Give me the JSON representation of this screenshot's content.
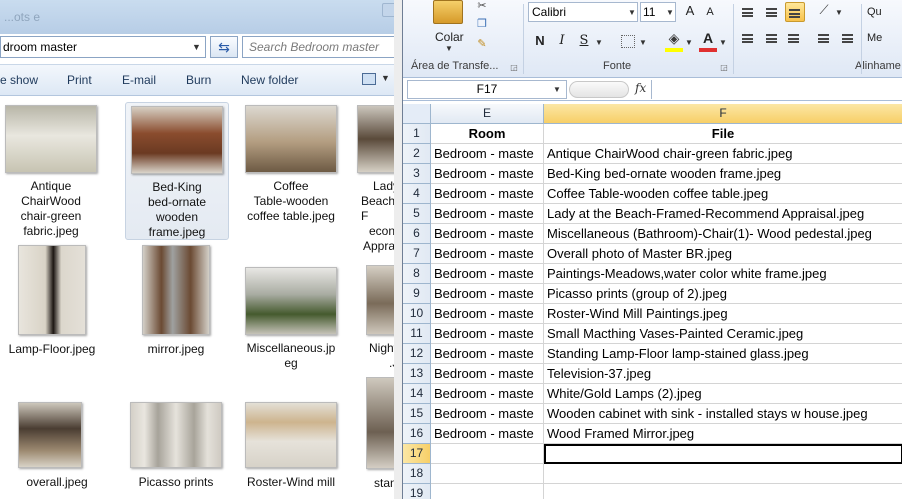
{
  "explorer": {
    "title_ghost": "...ots e",
    "address": "droom master",
    "search_placeholder": "Search Bedroom master",
    "toolbar": {
      "slideshow": "e show",
      "print": "Print",
      "email": "E-mail",
      "burn": "Burn",
      "new_folder": "New folder"
    },
    "files": [
      {
        "label": "Antique ChairWood chair-green fabric.jpeg",
        "lines": [
          "Antique",
          "ChairWood",
          "chair-green",
          "fabric.jpeg"
        ]
      },
      {
        "label": "Bed-King bed-ornate wooden frame.jpeg",
        "lines": [
          "Bed-King",
          "bed-ornate",
          "wooden",
          "frame.jpeg"
        ]
      },
      {
        "label": "Coffee Table-wooden coffee table.jpeg",
        "lines": [
          "Coffee",
          "Table-wooden",
          "coffee table.jpeg"
        ]
      },
      {
        "label": "Lady at the Beach-Framed-Recommend Appraisal.jpeg",
        "lines": [
          "Lady",
          "Beach-F",
          "econ",
          "Apprai"
        ]
      },
      {
        "label": "Lamp-Floor.jpeg",
        "lines": [
          "Lamp-Floor.jpeg"
        ]
      },
      {
        "label": "mirror.jpeg",
        "lines": [
          "mirror.jpeg"
        ]
      },
      {
        "label": "Miscellaneous.jpeg",
        "lines": [
          "Miscellaneous.jp",
          "eg"
        ]
      },
      {
        "label": "Night...",
        "lines": [
          "Night",
          ".J"
        ]
      },
      {
        "label": "overall.jpeg",
        "lines": [
          "overall.jpeg"
        ]
      },
      {
        "label": "Picasso prints",
        "lines": [
          "Picasso prints"
        ]
      },
      {
        "label": "Roster-Wind mill",
        "lines": [
          "Roster-Wind mill"
        ]
      },
      {
        "label": "stan",
        "lines": [
          "stan"
        ]
      }
    ]
  },
  "excel": {
    "ribbon": {
      "paste_label": "Colar",
      "clipboard_group": "Área de Transfe...",
      "font_name": "Calibri",
      "font_size": "11",
      "grow_font": "A",
      "shrink_font": "A",
      "bold": "N",
      "italic": "I",
      "underline": "S",
      "font_group": "Fonte",
      "alignment_group": "Alinhame",
      "right_top": "Qu",
      "right_mid": "Me"
    },
    "name_box": "F17",
    "fx_label": "fx",
    "columns": [
      {
        "id": "E",
        "active": false
      },
      {
        "id": "F",
        "active": true
      }
    ],
    "rows": [
      {
        "num": "1",
        "e": "Room",
        "f": "File",
        "header": true
      },
      {
        "num": "2",
        "e": "Bedroom - maste",
        "f": "Antique ChairWood chair-green fabric.jpeg"
      },
      {
        "num": "3",
        "e": "Bedroom - maste",
        "f": "Bed-King bed-ornate wooden frame.jpeg"
      },
      {
        "num": "4",
        "e": "Bedroom - maste",
        "f": "Coffee Table-wooden coffee table.jpeg"
      },
      {
        "num": "5",
        "e": "Bedroom - maste",
        "f": "Lady at the Beach-Framed-Recommend Appraisal.jpeg"
      },
      {
        "num": "6",
        "e": "Bedroom - maste",
        "f": "Miscellaneous (Bathroom)-Chair(1)- Wood pedestal.jpeg"
      },
      {
        "num": "7",
        "e": "Bedroom - maste",
        "f": "Overall photo of Master BR.jpeg"
      },
      {
        "num": "8",
        "e": "Bedroom - maste",
        "f": "Paintings-Meadows,water color white frame.jpeg"
      },
      {
        "num": "9",
        "e": "Bedroom - maste",
        "f": "Picasso prints (group of 2).jpeg"
      },
      {
        "num": "10",
        "e": "Bedroom - maste",
        "f": "Roster-Wind Mill Paintings.jpeg"
      },
      {
        "num": "11",
        "e": "Bedroom - maste",
        "f": "Small Macthing Vases-Painted Ceramic.jpeg"
      },
      {
        "num": "12",
        "e": "Bedroom - maste",
        "f": "Standing Lamp-Floor lamp-stained glass.jpeg"
      },
      {
        "num": "13",
        "e": "Bedroom - maste",
        "f": "Television-37.jpeg"
      },
      {
        "num": "14",
        "e": "Bedroom - maste",
        "f": "White/Gold Lamps (2).jpeg"
      },
      {
        "num": "15",
        "e": "Bedroom - maste",
        "f": "Wooden cabinet with sink - installed stays w house.jpeg"
      },
      {
        "num": "16",
        "e": "Bedroom - maste",
        "f": "Wood Framed Mirror.jpeg"
      },
      {
        "num": "17",
        "e": "",
        "f": "",
        "active": true
      },
      {
        "num": "18",
        "e": "",
        "f": ""
      },
      {
        "num": "19",
        "e": "",
        "f": ""
      }
    ],
    "colors": {
      "accent": "#f7cf67",
      "header_bg": "#e1e9f3",
      "gridline": "#d4d4d4"
    }
  }
}
